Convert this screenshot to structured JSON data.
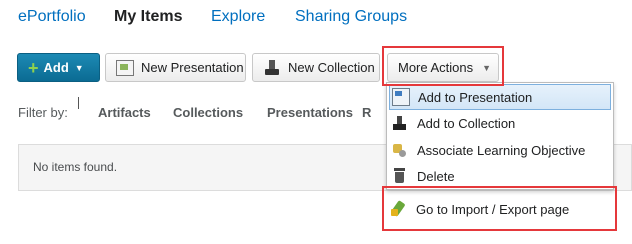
{
  "nav": {
    "items": [
      {
        "label": "ePortfolio"
      },
      {
        "label": "My Items"
      },
      {
        "label": "Explore"
      },
      {
        "label": "Sharing Groups"
      }
    ]
  },
  "toolbar": {
    "add_label": "Add",
    "new_presentation_label": "New Presentation",
    "new_collection_label": "New Collection",
    "more_actions_label": "More Actions"
  },
  "filter": {
    "label": "Filter by:",
    "items": [
      {
        "label": "Artifacts"
      },
      {
        "label": "Collections"
      },
      {
        "label": "Presentations"
      },
      {
        "label": "R"
      }
    ]
  },
  "list": {
    "empty_text": "No items found."
  },
  "menu": {
    "items": [
      {
        "label": "Add to Presentation",
        "icon": "presentation-icon"
      },
      {
        "label": "Add to Collection",
        "icon": "collection-icon"
      },
      {
        "label": "Associate Learning Objective",
        "icon": "learning-objective-icon"
      },
      {
        "label": "Delete",
        "icon": "trash-icon"
      },
      {
        "label": "Go to Import / Export page",
        "icon": "import-export-icon"
      }
    ]
  },
  "colors": {
    "link": "#006fbf",
    "primary_button": "#0b6b93",
    "highlight_box": "#e5383b"
  }
}
